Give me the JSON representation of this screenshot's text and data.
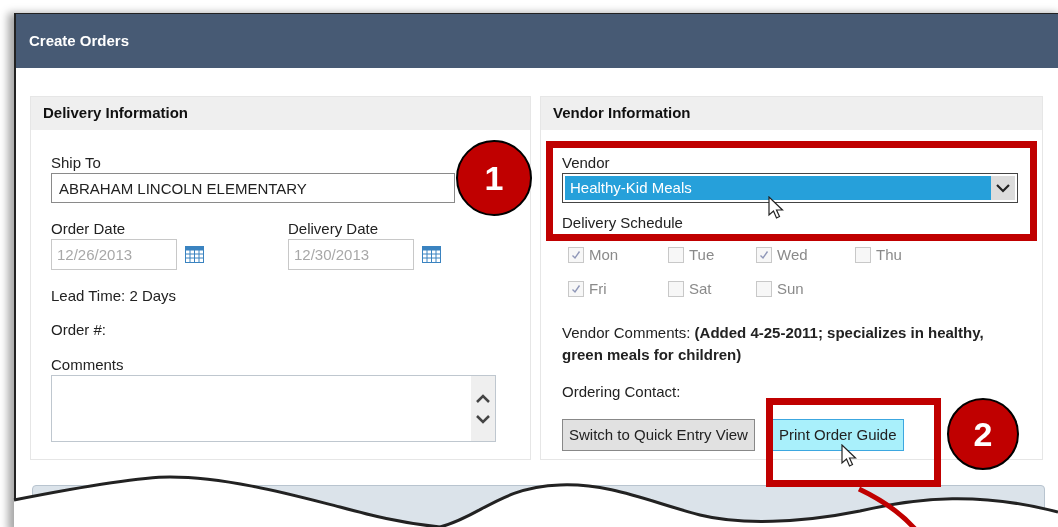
{
  "window": {
    "title": "Create Orders"
  },
  "delivery_panel": {
    "title": "Delivery Information",
    "ship_to": {
      "label": "Ship To",
      "value": "ABRAHAM LINCOLN ELEMENTARY"
    },
    "order_date": {
      "label": "Order Date",
      "value": "12/26/2013",
      "disabled": true
    },
    "delivery_date": {
      "label": "Delivery Date",
      "value": "12/30/2013",
      "disabled": true
    },
    "lead_time": "Lead Time: 2 Days",
    "order_number": "Order #:",
    "comments": {
      "label": "Comments"
    }
  },
  "vendor_panel": {
    "title": "Vendor Information",
    "vendor": {
      "label": "Vendor",
      "value": "Healthy-Kid Meals",
      "highlighted": true
    },
    "delivery_schedule": {
      "label": "Delivery Schedule",
      "disabled": true,
      "days": [
        {
          "label": "Mon",
          "checked": true
        },
        {
          "label": "Tue",
          "checked": false
        },
        {
          "label": "Wed",
          "checked": true
        },
        {
          "label": "Thu",
          "checked": false
        },
        {
          "label": "Fri",
          "checked": true
        },
        {
          "label": "Sat",
          "checked": false
        },
        {
          "label": "Sun",
          "checked": false
        }
      ]
    },
    "vendor_comments": "Vendor Comments: **(Added 4-25-2011; specializes in healthy, green meals for children)**",
    "ordering_contact": "Ordering Contact:",
    "buttons": [
      {
        "label": "Switch to Quick Entry View",
        "hovered": false
      },
      {
        "label": "Print Order Guide",
        "hovered": true
      }
    ]
  },
  "callouts": [
    {
      "number": "1"
    },
    {
      "number": "2"
    }
  ]
}
